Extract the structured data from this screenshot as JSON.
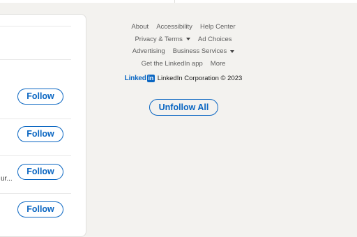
{
  "suggestions": {
    "follow_buttons": [
      {
        "label": "Follow"
      },
      {
        "label": "Follow"
      },
      {
        "label": "Follow"
      },
      {
        "label": "Follow"
      }
    ],
    "truncated_text": "ur..."
  },
  "footer": {
    "row1": [
      "About",
      "Accessibility",
      "Help Center"
    ],
    "privacy_terms": "Privacy & Terms",
    "ad_choices": "Ad Choices",
    "advertising": "Advertising",
    "business_services": "Business Services",
    "get_app": "Get the LinkedIn app",
    "more": "More",
    "logo_text": "Linked",
    "logo_box": "in",
    "copyright": "LinkedIn Corporation © 2023"
  },
  "unfollow_all_label": "Unfollow All",
  "colors": {
    "accent": "#0a66c2",
    "background": "#f3f2ef",
    "card": "#ffffff"
  }
}
